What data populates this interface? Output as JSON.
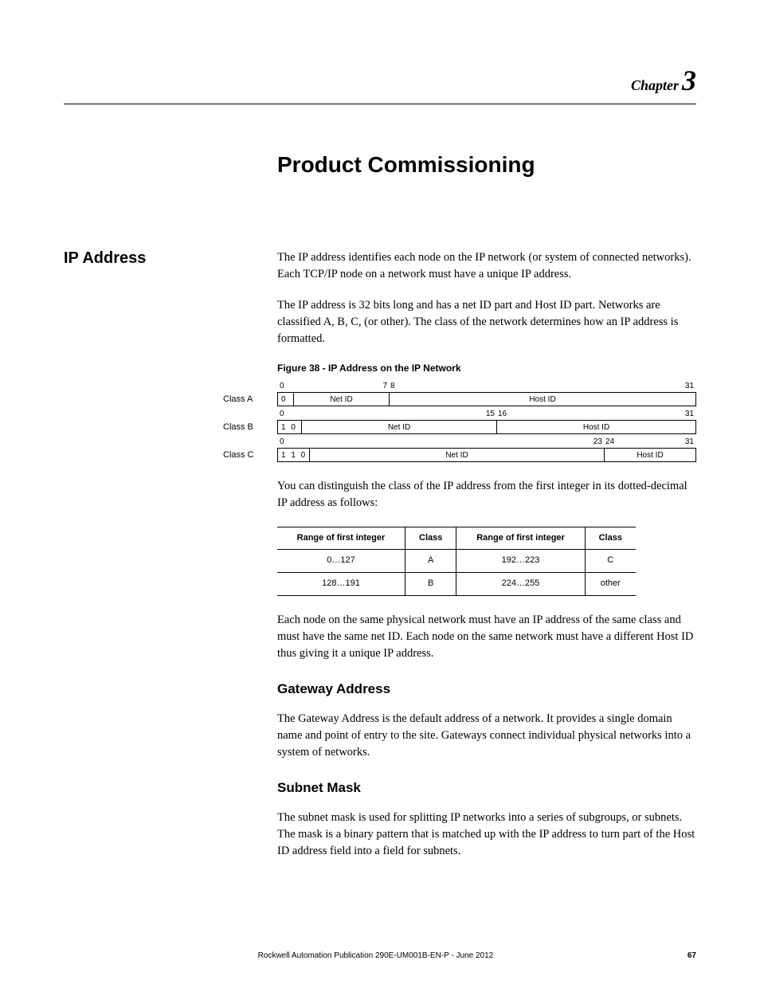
{
  "chapter": {
    "word": "Chapter",
    "num": "3"
  },
  "title": "Product Commissioning",
  "section_heading": "IP Address",
  "para1": "The IP address identifies each node on the IP network (or system of connected networks). Each TCP/IP node on a network must have a unique IP address.",
  "para2": "The IP address is 32 bits long and has a net ID part and Host ID part. Networks are classified A, B, C, (or other). The class of the network determines how an IP address is formatted.",
  "fig_caption": "Figure 38 - IP Address on the IP Network",
  "diagram": {
    "rowA": {
      "label": "Class A",
      "n0": "0",
      "nmid1": "7",
      "nmid2": "8",
      "nend": "31",
      "prefix": "0",
      "seg1": "Net ID",
      "seg2": "Host ID"
    },
    "rowB": {
      "label": "Class B",
      "n0": "0",
      "nmid1": "15",
      "nmid2": "16",
      "nend": "31",
      "prefix": "1 0",
      "seg1": "Net ID",
      "seg2": "Host ID"
    },
    "rowC": {
      "label": "Class C",
      "n0": "0",
      "nmid1": "23",
      "nmid2": "24",
      "nend": "31",
      "prefix": "1 1 0",
      "seg1": "Net ID",
      "seg2": "Host ID"
    }
  },
  "para3": "You can distinguish the class of the IP address from the first integer in its dotted-decimal IP address as follows:",
  "table": {
    "h1": "Range of first integer",
    "h2": "Class",
    "h3": "Range of first integer",
    "h4": "Class",
    "r1c1": "0…127",
    "r1c2": "A",
    "r1c3": "192…223",
    "r1c4": "C",
    "r2c1": "128…191",
    "r2c2": "B",
    "r2c3": "224…255",
    "r2c4": "other"
  },
  "para4": "Each node on the same physical network must have an IP address of the same class and must have the same net ID. Each node on the same network must have a different Host ID thus giving it a unique IP address.",
  "sub1_head": "Gateway Address",
  "sub1_body": "The Gateway Address is the default address of a network. It provides a single domain name and point of entry to the site. Gateways connect individual physical networks into a system of networks.",
  "sub2_head": "Subnet Mask",
  "sub2_body": "The subnet mask is used for splitting IP networks into a series of subgroups, or subnets. The mask is a binary pattern that is matched up with the IP address to turn part of the Host ID address field into a field for subnets.",
  "footer": {
    "pub": "Rockwell Automation Publication 290E-UM001B-EN-P - June 2012",
    "page": "67"
  }
}
